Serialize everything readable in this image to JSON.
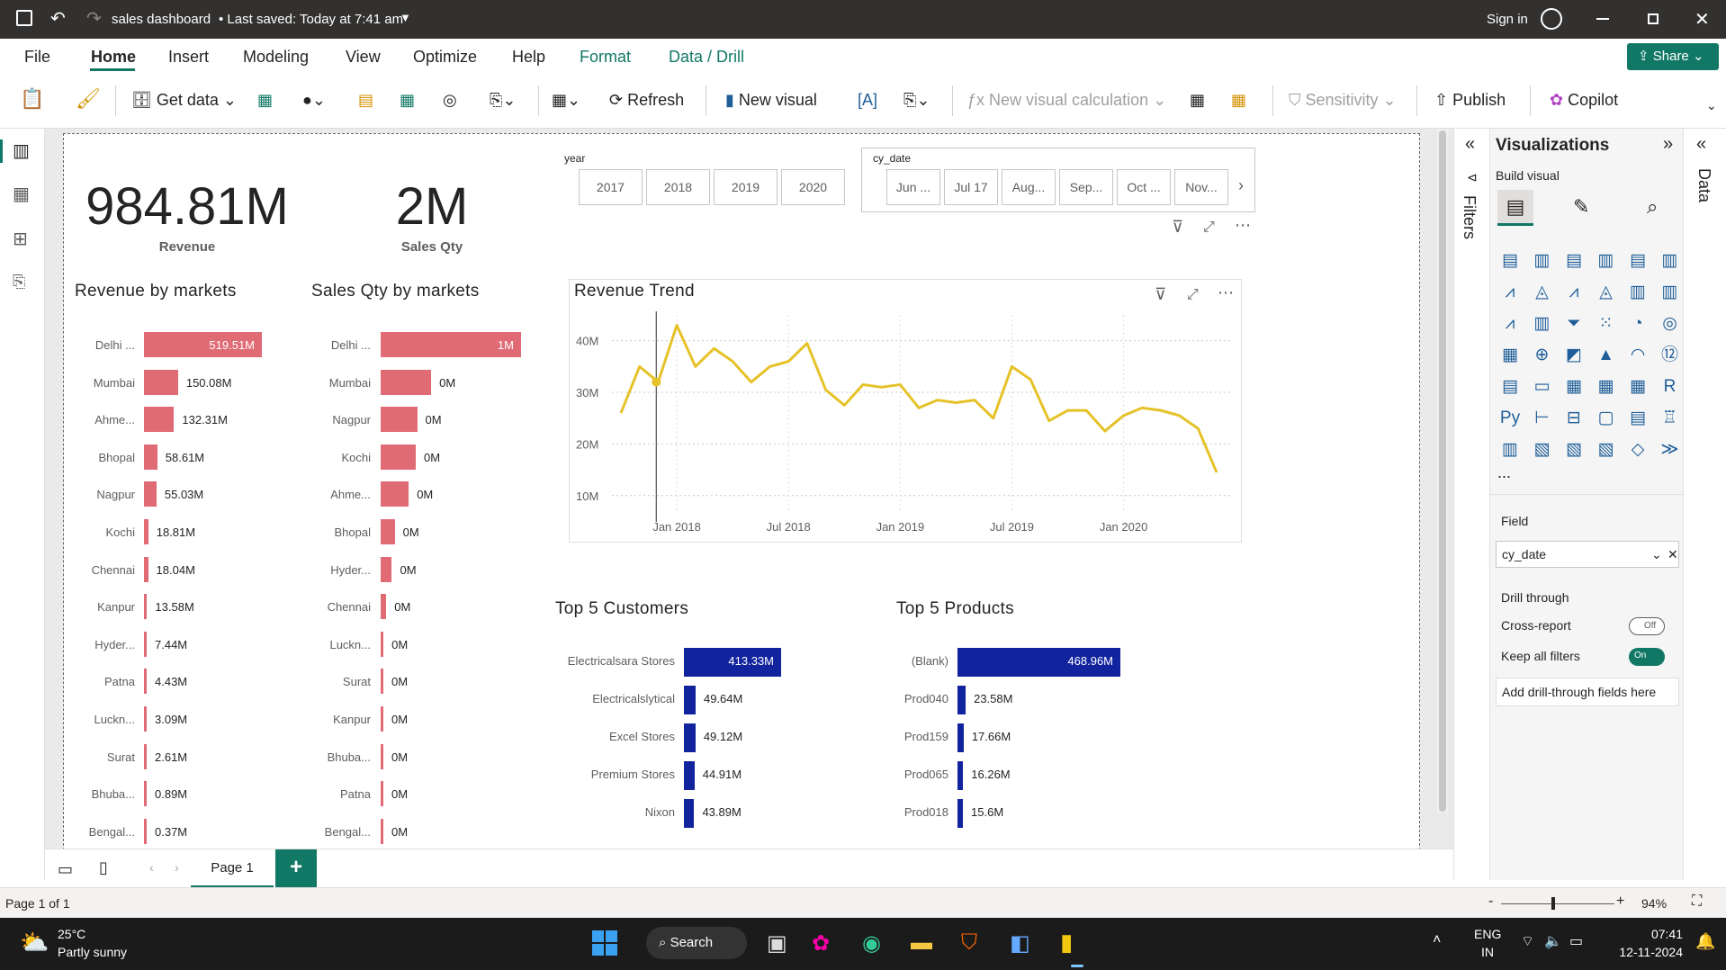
{
  "titlebar": {
    "file_title": "sales dashboard",
    "saved": "• Last saved: Today at 7:41 am",
    "sign_in": "Sign in"
  },
  "menu": {
    "items": [
      "File",
      "Home",
      "Insert",
      "Modeling",
      "View",
      "Optimize",
      "Help",
      "Format",
      "Data / Drill"
    ],
    "share": "Share"
  },
  "ribbon": {
    "get_data": "Get data",
    "refresh": "Refresh",
    "new_visual": "New visual",
    "new_visual_calc": "New visual calculation",
    "sensitivity": "Sensitivity",
    "publish": "Publish",
    "copilot": "Copilot"
  },
  "kpis": [
    {
      "value": "984.81M",
      "label": "Revenue"
    },
    {
      "value": "2M",
      "label": "Sales Qty"
    }
  ],
  "year_slicer": {
    "title": "year",
    "options": [
      "2017",
      "2018",
      "2019",
      "2020"
    ]
  },
  "date_slicer": {
    "title": "cy_date",
    "options": [
      "Jun ...",
      "Jul 17",
      "Aug...",
      "Sep...",
      "Oct ...",
      "Nov..."
    ]
  },
  "revenue_by_markets": {
    "title": "Revenue by markets",
    "rows": [
      {
        "cat": "Delhi ...",
        "label": "519.51M",
        "value": 519.51
      },
      {
        "cat": "Mumbai",
        "label": "150.08M",
        "value": 150.08
      },
      {
        "cat": "Ahme...",
        "label": "132.31M",
        "value": 132.31
      },
      {
        "cat": "Bhopal",
        "label": "58.61M",
        "value": 58.61
      },
      {
        "cat": "Nagpur",
        "label": "55.03M",
        "value": 55.03
      },
      {
        "cat": "Kochi",
        "label": "18.81M",
        "value": 18.81
      },
      {
        "cat": "Chennai",
        "label": "18.04M",
        "value": 18.04
      },
      {
        "cat": "Kanpur",
        "label": "13.58M",
        "value": 13.58
      },
      {
        "cat": "Hyder...",
        "label": "7.44M",
        "value": 7.44
      },
      {
        "cat": "Patna",
        "label": "4.43M",
        "value": 4.43
      },
      {
        "cat": "Luckn...",
        "label": "3.09M",
        "value": 3.09
      },
      {
        "cat": "Surat",
        "label": "2.61M",
        "value": 2.61
      },
      {
        "cat": "Bhuba...",
        "label": "0.89M",
        "value": 0.89
      },
      {
        "cat": "Bengal...",
        "label": "0.37M",
        "value": 0.37
      }
    ]
  },
  "sales_qty_by_markets": {
    "title": "Sales Qty by markets",
    "rows": [
      {
        "cat": "Delhi ...",
        "label": "1M",
        "value": 1.0
      },
      {
        "cat": "Mumbai",
        "label": "0M",
        "value": 0.36
      },
      {
        "cat": "Nagpur",
        "label": "0M",
        "value": 0.26
      },
      {
        "cat": "Kochi",
        "label": "0M",
        "value": 0.25
      },
      {
        "cat": "Ahme...",
        "label": "0M",
        "value": 0.2
      },
      {
        "cat": "Bhopal",
        "label": "0M",
        "value": 0.1
      },
      {
        "cat": "Hyder...",
        "label": "0M",
        "value": 0.08
      },
      {
        "cat": "Chennai",
        "label": "0M",
        "value": 0.04
      },
      {
        "cat": "Luckn...",
        "label": "0M",
        "value": 0.02
      },
      {
        "cat": "Surat",
        "label": "0M",
        "value": 0.015
      },
      {
        "cat": "Kanpur",
        "label": "0M",
        "value": 0.012
      },
      {
        "cat": "Bhuba...",
        "label": "0M",
        "value": 0.01
      },
      {
        "cat": "Patna",
        "label": "0M",
        "value": 0.008
      },
      {
        "cat": "Bengal...",
        "label": "0M",
        "value": 0.006
      }
    ]
  },
  "top_customers": {
    "title": "Top 5 Customers",
    "rows": [
      {
        "cat": "Electricalsara Stores",
        "label": "413.33M",
        "value": 413.33
      },
      {
        "cat": "Electricalslytical",
        "label": "49.64M",
        "value": 49.64
      },
      {
        "cat": "Excel Stores",
        "label": "49.12M",
        "value": 49.12
      },
      {
        "cat": "Premium Stores",
        "label": "44.91M",
        "value": 44.91
      },
      {
        "cat": "Nixon",
        "label": "43.89M",
        "value": 43.89
      }
    ]
  },
  "top_products": {
    "title": "Top 5 Products",
    "rows": [
      {
        "cat": "(Blank)",
        "label": "468.96M",
        "value": 468.96
      },
      {
        "cat": "Prod040",
        "label": "23.58M",
        "value": 23.58
      },
      {
        "cat": "Prod159",
        "label": "17.66M",
        "value": 17.66
      },
      {
        "cat": "Prod065",
        "label": "16.26M",
        "value": 16.26
      },
      {
        "cat": "Prod018",
        "label": "15.6M",
        "value": 15.6
      }
    ]
  },
  "chart_data": {
    "type": "line",
    "title": "Revenue Trend",
    "xlabel": "",
    "ylabel": "",
    "x_ticks": [
      "Jan 2018",
      "Jul 2018",
      "Jan 2019",
      "Jul 2019",
      "Jan 2020"
    ],
    "y_ticks": [
      "10M",
      "20M",
      "30M",
      "40M"
    ],
    "ylim": [
      7,
      45
    ],
    "x": [
      "2017-10",
      "2017-11",
      "2017-12",
      "2018-01",
      "2018-02",
      "2018-03",
      "2018-04",
      "2018-05",
      "2018-06",
      "2018-07",
      "2018-08",
      "2018-09",
      "2018-10",
      "2018-11",
      "2018-12",
      "2019-01",
      "2019-02",
      "2019-03",
      "2019-04",
      "2019-05",
      "2019-06",
      "2019-07",
      "2019-08",
      "2019-09",
      "2019-10",
      "2019-11",
      "2019-12",
      "2020-01",
      "2020-02",
      "2020-03",
      "2020-04",
      "2020-05",
      "2020-06"
    ],
    "values": [
      26,
      35,
      32,
      43,
      35,
      38.5,
      36,
      32,
      35,
      36,
      39.5,
      30.5,
      27.5,
      31.5,
      31,
      31.5,
      27,
      28.5,
      28,
      28.5,
      25,
      35,
      32.5,
      24.5,
      26.5,
      26.5,
      22.5,
      25.5,
      27,
      26.5,
      25.5,
      23,
      14.5
    ],
    "series": [
      {
        "name": "",
        "color": "#e6c229"
      }
    ]
  },
  "visualizations": {
    "title": "Visualizations",
    "build": "Build visual",
    "field_label": "Field",
    "field_value": "cy_date",
    "drill": "Drill through",
    "cross": "Cross-report",
    "cross_state": "Off",
    "keep": "Keep all filters",
    "keep_state": "On",
    "add": "Add drill-through fields here",
    "more": "..."
  },
  "side": {
    "filters": "Filters",
    "data": "Data"
  },
  "pages": {
    "tab": "Page 1",
    "add": "+"
  },
  "status": {
    "page": "Page 1 of 1",
    "zoom": "94%",
    "minus": "-",
    "plus": "+"
  },
  "taskbar": {
    "temp": "25°C",
    "weather": "Partly sunny",
    "search": "Search",
    "lang1": "ENG",
    "lang2": "IN",
    "time": "07:41",
    "date": "12-11-2024"
  },
  "colors": {
    "bar_red": "#e06b75",
    "bar_navy": "#12239e",
    "accent": "#117865",
    "line": "#e6c229"
  }
}
